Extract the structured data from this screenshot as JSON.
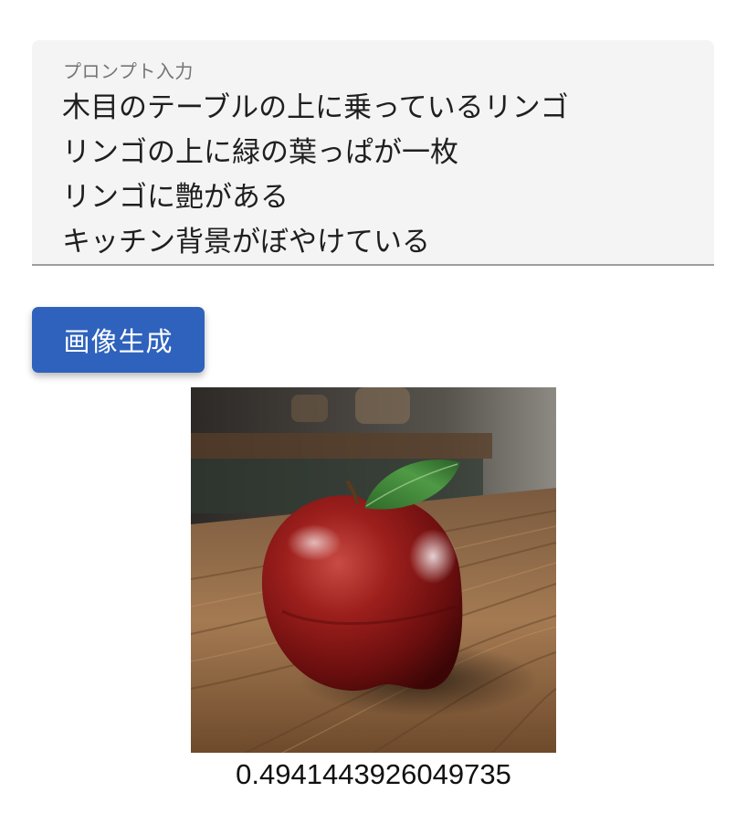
{
  "prompt": {
    "label": "プロンプト入力",
    "lines": [
      "木目のテーブルの上に乗っているリンゴ",
      "リンゴの上に緑の葉っぱが一枚",
      "リンゴに艶がある",
      "キッチン背景がぼやけている"
    ]
  },
  "generate_button": {
    "label": "画像生成"
  },
  "result": {
    "image_subject": "apple-on-wooden-table",
    "score": "0.4941443926049735"
  },
  "colors": {
    "button_bg": "#2f62bd",
    "field_bg": "#f4f4f4",
    "apple_red": "#8b1a1a",
    "leaf_green": "#3f8a3a",
    "wood": "#9a6b43"
  }
}
